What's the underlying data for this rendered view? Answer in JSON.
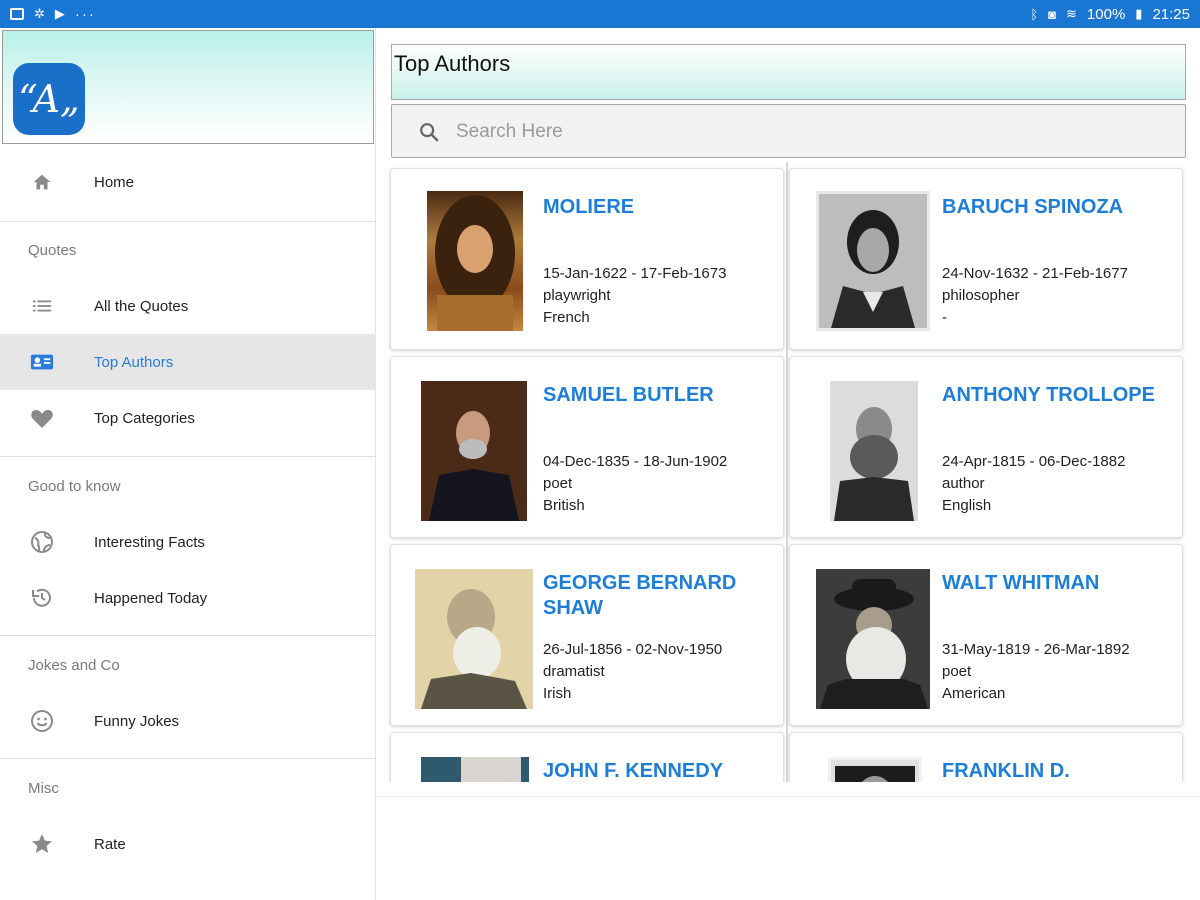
{
  "status_bar": {
    "battery": "100%",
    "time": "21:25",
    "overflow": "···"
  },
  "sidebar": {
    "logo_text": "“A„",
    "home": {
      "label": "Home",
      "icon": "home-icon"
    },
    "sections": [
      {
        "header": "Quotes",
        "items": [
          {
            "label": "All the Quotes",
            "icon": "list-icon"
          },
          {
            "label": "Top Authors",
            "icon": "contact-card-icon",
            "active": true
          },
          {
            "label": "Top Categories",
            "icon": "heart-icon"
          }
        ]
      },
      {
        "header": "Good to know",
        "items": [
          {
            "label": "Interesting Facts",
            "icon": "globe-icon"
          },
          {
            "label": "Happened Today",
            "icon": "history-icon"
          }
        ]
      },
      {
        "header": "Jokes and Co",
        "items": [
          {
            "label": "Funny Jokes",
            "icon": "smiley-icon"
          }
        ]
      },
      {
        "header": "Misc",
        "items": [
          {
            "label": "Rate",
            "icon": "star-icon"
          }
        ]
      }
    ]
  },
  "main": {
    "title": "Top Authors",
    "search": {
      "placeholder": "Search Here",
      "value": ""
    },
    "authors": [
      {
        "name": "MOLIERE",
        "dates": "15-Jan-1622 - 17-Feb-1673",
        "profession": "playwright",
        "nationality": "French"
      },
      {
        "name": "BARUCH SPINOZA",
        "dates": "24-Nov-1632 - 21-Feb-1677",
        "profession": "philosopher",
        "nationality": "-"
      },
      {
        "name": "SAMUEL BUTLER",
        "dates": "04-Dec-1835 - 18-Jun-1902",
        "profession": "poet",
        "nationality": "British"
      },
      {
        "name": "ANTHONY TROLLOPE",
        "dates": "24-Apr-1815 - 06-Dec-1882",
        "profession": "author",
        "nationality": "English"
      },
      {
        "name": "GEORGE BERNARD SHAW",
        "dates": "26-Jul-1856 - 02-Nov-1950",
        "profession": "dramatist",
        "nationality": "Irish"
      },
      {
        "name": "WALT WHITMAN",
        "dates": "31-May-1819 - 26-Mar-1892",
        "profession": "poet",
        "nationality": "American"
      },
      {
        "name": "JOHN F. KENNEDY",
        "dates": "",
        "profession": "",
        "nationality": ""
      },
      {
        "name": "FRANKLIN D.",
        "dates": "",
        "profession": "",
        "nationality": ""
      }
    ]
  },
  "colors": {
    "status_bar": "#1976d2",
    "accent": "#1e7ed6",
    "active_row": "#e6e6e6",
    "header_gradient": "#b9f0e8"
  }
}
